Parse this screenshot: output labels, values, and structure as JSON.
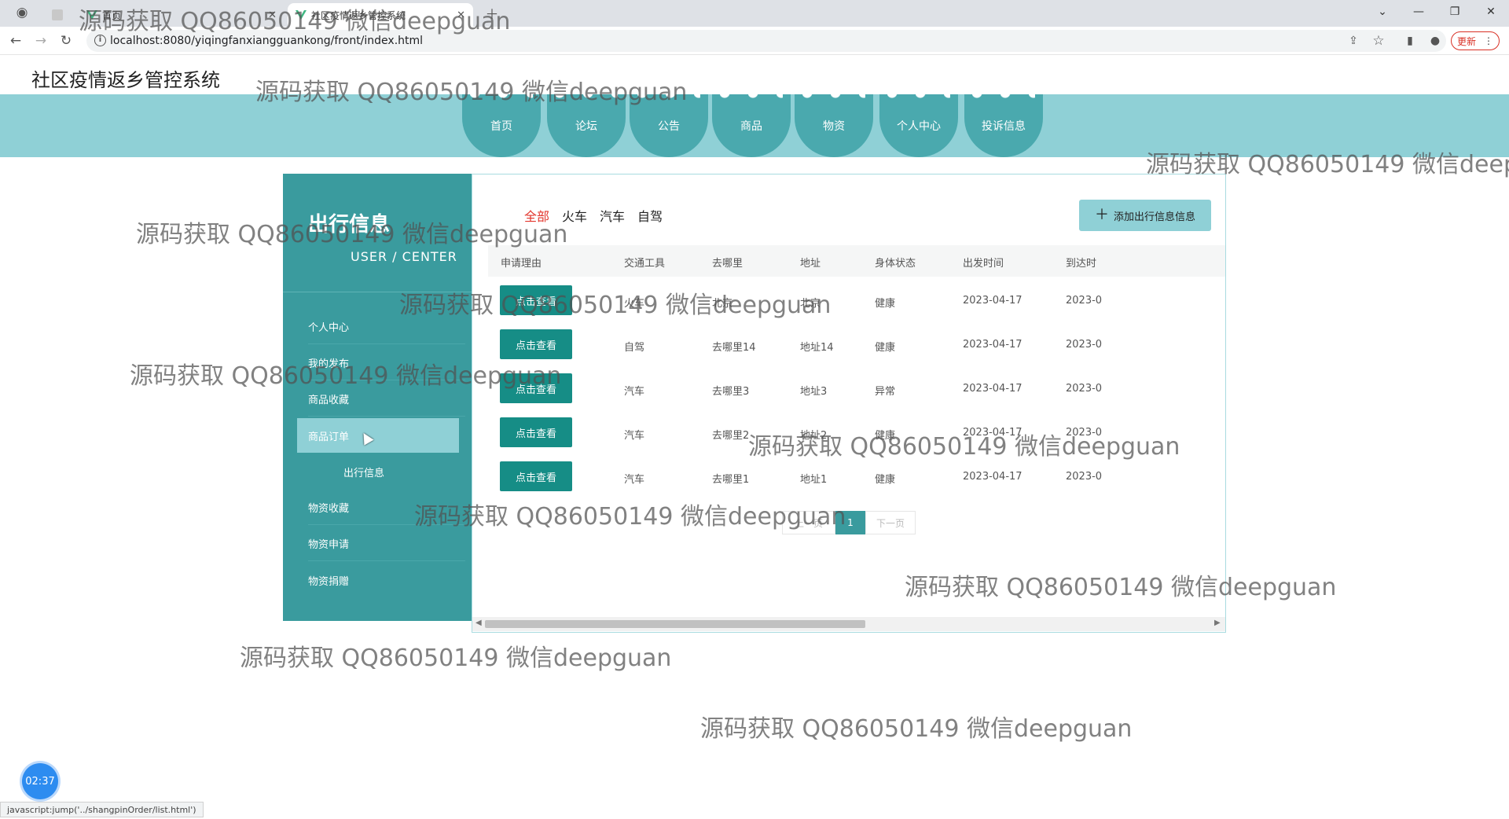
{
  "browser": {
    "tabs": [
      {
        "title": "首页"
      },
      {
        "title": "社区疫情返乡管控系统"
      }
    ],
    "url": "localhost:8080/yiqingfanxiangguankong/front/index.html",
    "update_label": "更新",
    "status_url": "javascript:jump('../shangpinOrder/list.html')"
  },
  "site": {
    "title": "社区疫情返乡管控系统",
    "nav": [
      "首页",
      "论坛",
      "公告",
      "商品",
      "物资",
      "个人中心",
      "投诉信息"
    ]
  },
  "sidebar": {
    "title": "出行信息",
    "subtitle": "USER / CENTER",
    "items": [
      "个人中心",
      "我的发布",
      "商品收藏",
      "商品订单",
      "出行信息",
      "物资收藏",
      "物资申请",
      "物资捐赠"
    ]
  },
  "main": {
    "filters": [
      "全部",
      "火车",
      "汽车",
      "自驾"
    ],
    "add_button": "添加出行信息信息",
    "columns": [
      "申请理由",
      "交通工具",
      "去哪里",
      "地址",
      "身体状态",
      "出发时间",
      "到达时"
    ],
    "view_label": "点击查看",
    "rows": [
      {
        "vehicle": "火车",
        "dest": "北京",
        "addr": "北京",
        "health": "健康",
        "depart": "2023-04-17",
        "arrive": "2023-0"
      },
      {
        "vehicle": "自驾",
        "dest": "去哪里14",
        "addr": "地址14",
        "health": "健康",
        "depart": "2023-04-17",
        "arrive": "2023-0"
      },
      {
        "vehicle": "汽车",
        "dest": "去哪里3",
        "addr": "地址3",
        "health": "异常",
        "depart": "2023-04-17",
        "arrive": "2023-0"
      },
      {
        "vehicle": "汽车",
        "dest": "去哪里2",
        "addr": "地址2",
        "health": "健康",
        "depart": "2023-04-17",
        "arrive": "2023-0"
      },
      {
        "vehicle": "汽车",
        "dest": "去哪里1",
        "addr": "地址1",
        "health": "健康",
        "depart": "2023-04-17",
        "arrive": "2023-0"
      }
    ],
    "pager": {
      "prev": "上一页",
      "current": "1",
      "next": "下一页"
    }
  },
  "watermark": "源码获取 QQ86050149 微信deepguan",
  "timer": "02:37"
}
